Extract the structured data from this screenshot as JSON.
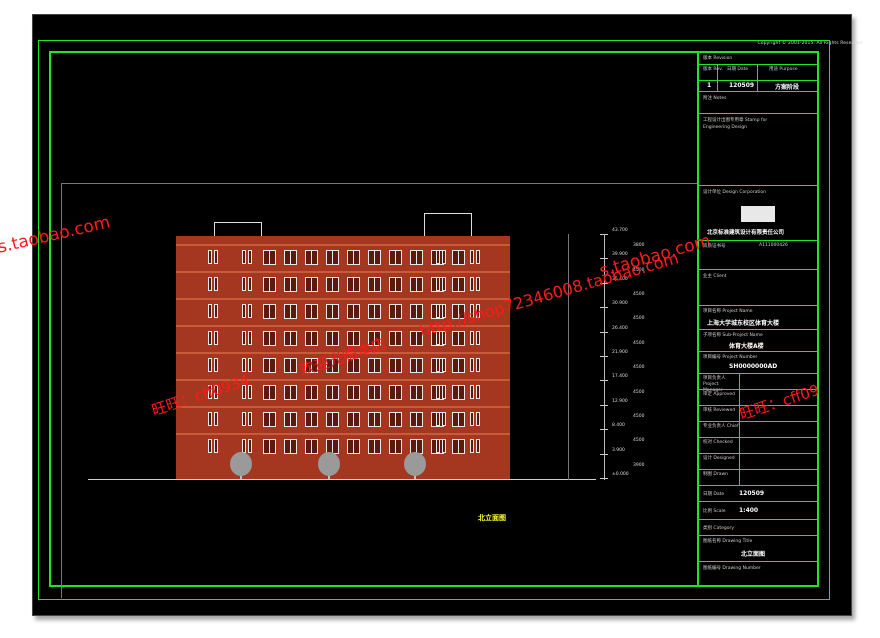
{
  "copyright": "Copyright © 2001-2015. All Rights Reserved",
  "drawing_caption": "北立面图",
  "title_block": {
    "revision_label": "版本 Revision",
    "rev_col": "版本 Rev.",
    "date_col": "日期 Date",
    "purpose_col": "用途 Purpose",
    "rev_value": "1",
    "date_value": "120509",
    "purpose_value": "方案阶段",
    "notes_label": "附注 Notes",
    "stamp_label": "工程设计出图专用章 Stamp for Engineering Design",
    "design_corp_label": "设计单位 Design Corporation",
    "company": "北京标准建筑设计有限责任公司",
    "cert_label": "资质证书号",
    "cert_value": "A111000426",
    "client_label": "业主 Client",
    "project_label": "项目名称 Project Name",
    "project_value": "上海大学城东校区体育大楼",
    "subproject_label": "子项名称 Sub-Project Name",
    "subproject_value": "体育大楼A楼",
    "projno_label": "项目编号 Project Number",
    "projno_value": "SH0000000AD",
    "manager_label": "项目负责人 Project Manager",
    "approved_label": "审定 Approved",
    "reviewed_label": "审核 Reviewed",
    "chief_label": "专业负责人 Chief",
    "checked_label": "校对 Checked",
    "designed_label": "设计 Designed",
    "drawn_label": "制图 Drawn",
    "date2_label": "日期 Date",
    "date2_value": "120509",
    "scale_label": "比例 Scale",
    "scale_value": "1:400",
    "category_label": "类别 Category",
    "title_label": "图纸名称 Drawing Title",
    "title_value": "北立面图",
    "number_label": "图纸编号 Drawing Number"
  },
  "levels": [
    {
      "elev": "43.700",
      "h": "3800"
    },
    {
      "elev": "39.900",
      "h": "4500"
    },
    {
      "elev": "35.400",
      "h": "4500"
    },
    {
      "elev": "30.900",
      "h": "4500"
    },
    {
      "elev": "26.400",
      "h": "4500"
    },
    {
      "elev": "21.900",
      "h": "4500"
    },
    {
      "elev": "17.400",
      "h": "4500"
    },
    {
      "elev": "12.900",
      "h": "4500"
    },
    {
      "elev": "8.400",
      "h": "4500"
    },
    {
      "elev": "3.900",
      "h": "3900"
    },
    {
      "elev": "±0.000",
      "h": ""
    }
  ],
  "watermarks": {
    "shop": "s.taobao.com",
    "wangwang_left": "旺旺：cff0934",
    "shop_url": "http://shop72346008.taobao.com",
    "wangwang_right": "旺旺：cff09",
    "slogan": "欢迎光临本店"
  }
}
